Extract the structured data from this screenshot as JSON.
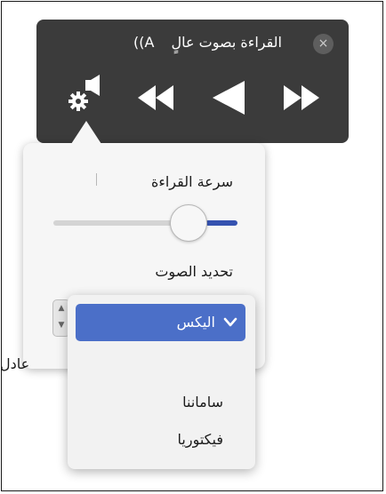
{
  "toolbar": {
    "title": "القراءة بصوت عالٍ",
    "title_icon": "A))",
    "close_glyph": "×",
    "buttons": [
      "settings-icon",
      "rewind-icon",
      "play-icon",
      "fast-forward-icon"
    ]
  },
  "settings": {
    "speed_label": "سرعة القراءة",
    "speed_value": 0.76,
    "voice_label": "تحديد الصوت"
  },
  "side_text": "عادل",
  "voice_menu": {
    "selected": "اليكس",
    "items": [
      "ساماننا",
      "فيكتوريا"
    ]
  },
  "colors": {
    "toolbar_bg": "#3b3b3b",
    "accent": "#3552b0",
    "selection": "#4b6fc8"
  }
}
